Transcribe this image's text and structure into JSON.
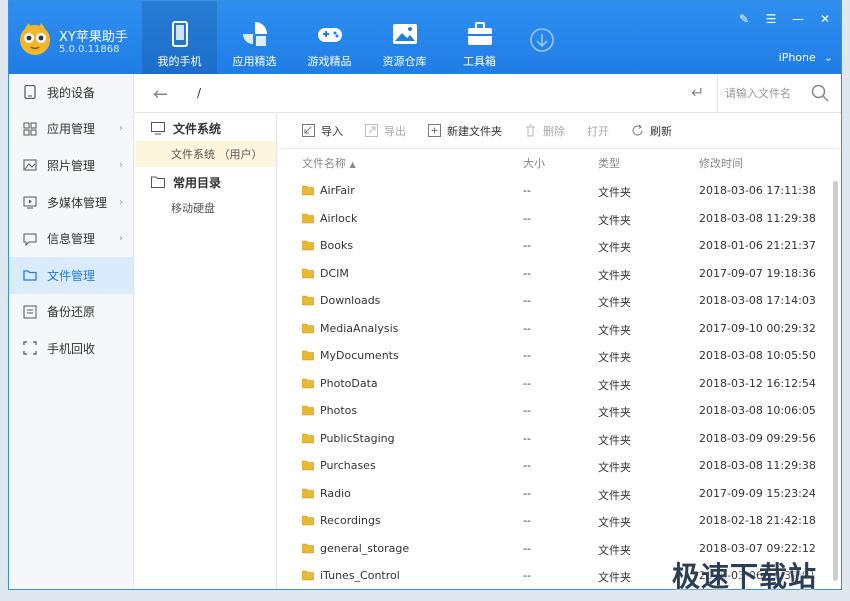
{
  "app": {
    "name": "XY苹果助手",
    "version": "5.0.0.11868"
  },
  "nav": [
    {
      "label": "我的手机",
      "icon": "phone-icon",
      "active": true
    },
    {
      "label": "应用精选",
      "icon": "apps-icon"
    },
    {
      "label": "游戏精品",
      "icon": "gamepad-icon"
    },
    {
      "label": "资源仓库",
      "icon": "image-icon"
    },
    {
      "label": "工具箱",
      "icon": "toolbox-icon"
    }
  ],
  "device": {
    "name": "iPhone"
  },
  "sidebar": {
    "items": [
      {
        "label": "我的设备",
        "icon": "device-icon"
      },
      {
        "label": "应用管理",
        "icon": "grid-icon"
      },
      {
        "label": "照片管理",
        "icon": "photo-icon"
      },
      {
        "label": "多媒体管理",
        "icon": "media-icon"
      },
      {
        "label": "信息管理",
        "icon": "message-icon"
      },
      {
        "label": "文件管理",
        "icon": "folder-icon",
        "active": true
      },
      {
        "label": "备份还原",
        "icon": "backup-icon"
      },
      {
        "label": "手机回收",
        "icon": "recycle-icon"
      }
    ]
  },
  "tree": {
    "filesystem": {
      "label": "文件系统",
      "child": "文件系统 （用户）"
    },
    "common": {
      "label": "常用目录",
      "child": "移动硬盘"
    }
  },
  "pathbar": {
    "path": "/",
    "search_placeholder": "请输入文件名"
  },
  "toolbar": {
    "import": "导入",
    "export": "导出",
    "new_folder": "新建文件夹",
    "delete": "删除",
    "open": "打开",
    "refresh": "刷新"
  },
  "columns": {
    "name": "文件名称",
    "size": "大小",
    "type": "类型",
    "time": "修改时间"
  },
  "files": [
    {
      "name": "AirFair",
      "size": "--",
      "type": "文件夹",
      "time": "2018-03-06 17:11:38"
    },
    {
      "name": "Airlock",
      "size": "--",
      "type": "文件夹",
      "time": "2018-03-08 11:29:38"
    },
    {
      "name": "Books",
      "size": "--",
      "type": "文件夹",
      "time": "2018-01-06 21:21:37"
    },
    {
      "name": "DCIM",
      "size": "--",
      "type": "文件夹",
      "time": "2017-09-07 19:18:36"
    },
    {
      "name": "Downloads",
      "size": "--",
      "type": "文件夹",
      "time": "2018-03-08 17:14:03"
    },
    {
      "name": "MediaAnalysis",
      "size": "--",
      "type": "文件夹",
      "time": "2017-09-10 00:29:32"
    },
    {
      "name": "MyDocuments",
      "size": "--",
      "type": "文件夹",
      "time": "2018-03-08 10:05:50"
    },
    {
      "name": "PhotoData",
      "size": "--",
      "type": "文件夹",
      "time": "2018-03-12 16:12:54"
    },
    {
      "name": "Photos",
      "size": "--",
      "type": "文件夹",
      "time": "2018-03-08 10:06:05"
    },
    {
      "name": "PublicStaging",
      "size": "--",
      "type": "文件夹",
      "time": "2018-03-09 09:29:56"
    },
    {
      "name": "Purchases",
      "size": "--",
      "type": "文件夹",
      "time": "2018-03-08 11:29:38"
    },
    {
      "name": "Radio",
      "size": "--",
      "type": "文件夹",
      "time": "2017-09-09 15:23:24"
    },
    {
      "name": "Recordings",
      "size": "--",
      "type": "文件夹",
      "time": "2018-02-18 21:42:18"
    },
    {
      "name": "general_storage",
      "size": "--",
      "type": "文件夹",
      "time": "2018-03-07 09:22:12"
    },
    {
      "name": "iTunes_Control",
      "size": "--",
      "type": "文件夹",
      "time": "2018-03-06 10:32:01"
    }
  ],
  "watermark": "极速下载站",
  "colors": {
    "header": "#1f7de6",
    "active_bg": "#d9ebfc",
    "folder": "#e8b931",
    "selected_tree": "#fdf6dc"
  }
}
